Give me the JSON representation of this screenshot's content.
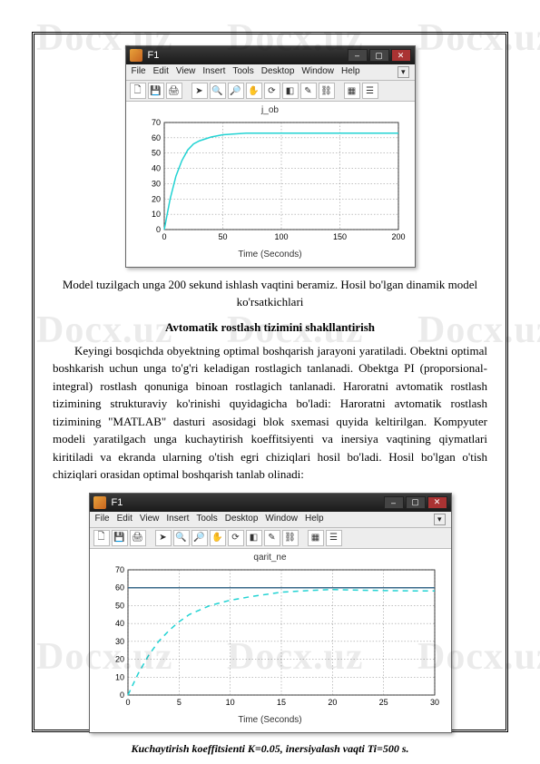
{
  "watermark": "Docx.uz",
  "figure1": {
    "window_title": "F1",
    "menu": [
      "File",
      "Edit",
      "View",
      "Insert",
      "Tools",
      "Desktop",
      "Window",
      "Help"
    ],
    "plot_title": "j_ob",
    "xlabel": "Time (Seconds)"
  },
  "figure2": {
    "window_title": "F1",
    "menu": [
      "File",
      "Edit",
      "View",
      "Insert",
      "Tools",
      "Desktop",
      "Window",
      "Help"
    ],
    "plot_title": "qarit_ne",
    "xlabel": "Time (Seconds)"
  },
  "chart_data": [
    {
      "type": "line",
      "title": "j_ob",
      "xlabel": "Time (Seconds)",
      "ylabel": "",
      "xlim": [
        0,
        200
      ],
      "ylim": [
        0,
        70
      ],
      "xticks": [
        0,
        50,
        100,
        150,
        200
      ],
      "yticks": [
        0,
        10,
        20,
        30,
        40,
        50,
        60,
        70
      ],
      "series": [
        {
          "name": "response",
          "color": "#22d3d3",
          "x": [
            0,
            5,
            10,
            15,
            20,
            25,
            30,
            40,
            50,
            60,
            70,
            80,
            100,
            120,
            150,
            200
          ],
          "y": [
            0,
            20,
            35,
            45,
            52,
            56,
            58,
            60.5,
            62,
            62.5,
            63,
            63,
            63,
            63,
            63,
            63
          ]
        }
      ]
    },
    {
      "type": "line",
      "title": "qarit_ne",
      "xlabel": "Time (Seconds)",
      "ylabel": "",
      "xlim": [
        0,
        30
      ],
      "ylim": [
        0,
        70
      ],
      "xticks": [
        0,
        5,
        10,
        15,
        20,
        25,
        30
      ],
      "yticks": [
        0,
        10,
        20,
        30,
        40,
        50,
        60,
        70
      ],
      "series": [
        {
          "name": "setpoint",
          "color": "#3a6a8a",
          "style": "solid",
          "x": [
            0,
            30
          ],
          "y": [
            60,
            60
          ]
        },
        {
          "name": "response",
          "color": "#22d3d3",
          "style": "dashed",
          "x": [
            0,
            1,
            2,
            3,
            4,
            5,
            6,
            8,
            10,
            12,
            15,
            18,
            20,
            22,
            25,
            28,
            30
          ],
          "y": [
            0,
            12,
            22,
            30,
            36,
            41,
            45,
            50,
            53,
            55,
            57.5,
            58.5,
            59,
            58.7,
            58.4,
            58.2,
            58.2
          ]
        }
      ]
    }
  ],
  "text": {
    "caption1": "Model tuzilgach unga 200 sekund ishlash vaqtini beramiz. Hosil bo'lgan dinamik model ko'rsatkichlari",
    "heading": "Avtomatik rostlash tizimini shakllantirish",
    "para1": "Keyingi bosqichda obyektning optimal boshqarish jarayoni yaratiladi. Obektni optimal boshkarish uchun unga to'g'ri keladigan rostlagich tanlanadi. Obektga PI (proporsional-integral) rostlash qonuniga binoan rostlagich tanlanadi. Haroratni avtomatik rostlash tizimining strukturaviy ko'rinishi quyidagicha bo'ladi: Haroratni avtomatik rostlash tizimining \"MATLAB\" dasturi asosidagi blok sxemasi quyida keltirilgan. Kompyuter modeli yaratilgach unga kuchaytirish koeffitsiyenti va inersiya vaqtining qiymatlari kiritiladi va ekranda ularning o'tish egri chiziqlari hosil bo'ladi. Hosil bo'lgan o'tish chiziqlari orasidan optimal boshqarish tanlab olinadi:",
    "figcaption": "Kuchaytirish koeffitsienti K=0.05, inersiyalash vaqti Ti=500 s."
  }
}
